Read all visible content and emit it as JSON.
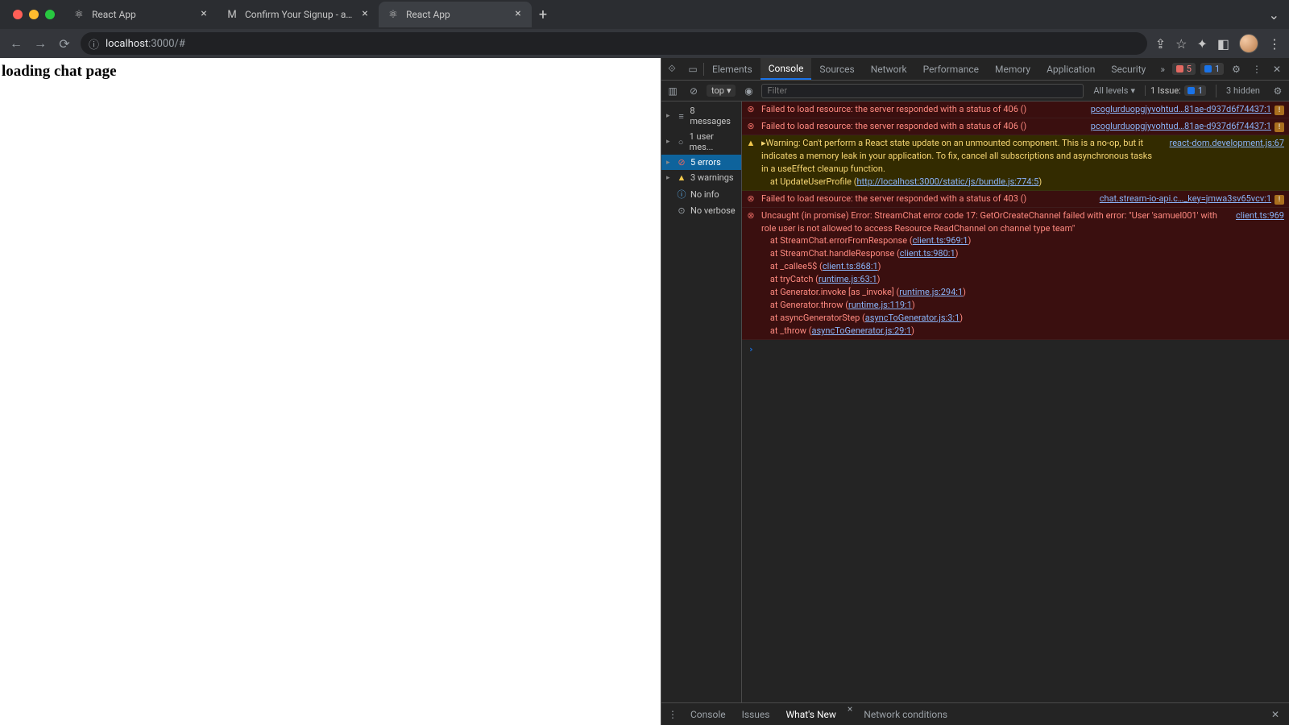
{
  "tabs": [
    {
      "title": "React App",
      "favicon": "⚛",
      "active": false
    },
    {
      "title": "Confirm Your Signup - ayodele",
      "favicon": "M",
      "active": false
    },
    {
      "title": "React App",
      "favicon": "⚛",
      "active": true
    }
  ],
  "address": {
    "host": "localhost",
    "port": ":3000",
    "path": "/#"
  },
  "page": {
    "heading": "loading chat page"
  },
  "devtools": {
    "tabs": [
      "Elements",
      "Console",
      "Sources",
      "Network",
      "Performance",
      "Memory",
      "Application",
      "Security"
    ],
    "active_tab": "Console",
    "error_count": "5",
    "issue_count": "1",
    "filter": {
      "context": "top",
      "placeholder": "Filter",
      "levels": "All levels",
      "issue_label": "1 Issue:",
      "issue_badge": "1",
      "hidden": "3 hidden"
    },
    "sidebar": [
      {
        "label": "8 messages",
        "icon": "≡",
        "cls": "msg",
        "exp": true
      },
      {
        "label": "1 user mes...",
        "icon": "○",
        "cls": "usr",
        "exp": true
      },
      {
        "label": "5 errors",
        "icon": "⊘",
        "cls": "err",
        "exp": true,
        "sel": true
      },
      {
        "label": "3 warnings",
        "icon": "▲",
        "cls": "warn",
        "exp": true
      },
      {
        "label": "No info",
        "icon": "ⓘ",
        "cls": "info",
        "exp": false
      },
      {
        "label": "No verbose",
        "icon": "⊙",
        "cls": "verb",
        "exp": false
      }
    ],
    "logs": [
      {
        "type": "error",
        "msg": "Failed to load resource: the server responded with a status of 406 ()",
        "src": "pcoglurduopgjyvohtud…81ae-d937d6f74437:1",
        "srcicon": true
      },
      {
        "type": "error",
        "msg": "Failed to load resource: the server responded with a status of 406 ()",
        "src": "pcoglurduopgjyvohtud…81ae-d937d6f74437:1",
        "srcicon": true
      },
      {
        "type": "warn",
        "msg": "▸Warning: Can't perform a React state update on an unmounted component. This is a no-op, but it indicates a memory leak in your application. To fix, cancel all subscriptions and asynchronous tasks in a useEffect cleanup function.\n    at UpdateUserProfile (http://localhost:3000/static/js/bundle.js:774:5)",
        "src": "react-dom.development.js:67",
        "lnk": "http://localhost:3000/static/js/bundle.js:774:5"
      },
      {
        "type": "error",
        "msg": "Failed to load resource: the server responded with a status of 403 ()",
        "src": "chat.stream-io-api.c…_key=jmwa3sv65vcv:1",
        "srcicon": true
      },
      {
        "type": "error",
        "msg": "Uncaught (in promise) Error: StreamChat error code 17: GetOrCreateChannel failed with error: \"User 'samuel001' with role user is not allowed to access Resource ReadChannel on channel type team\"\n    at StreamChat.errorFromResponse (client.ts:969:1)\n    at StreamChat.handleResponse (client.ts:980:1)\n    at _callee5$ (client.ts:868:1)\n    at tryCatch (runtime.js:63:1)\n    at Generator.invoke [as _invoke] (runtime.js:294:1)\n    at Generator.throw (runtime.js:119:1)\n    at asyncGeneratorStep (asyncToGenerator.js:3:1)\n    at _throw (asyncToGenerator.js:29:1)",
        "src": "client.ts:969"
      }
    ],
    "drawer": {
      "tabs": [
        "Console",
        "Issues",
        "What's New",
        "Network conditions"
      ],
      "active": "What's New"
    }
  }
}
